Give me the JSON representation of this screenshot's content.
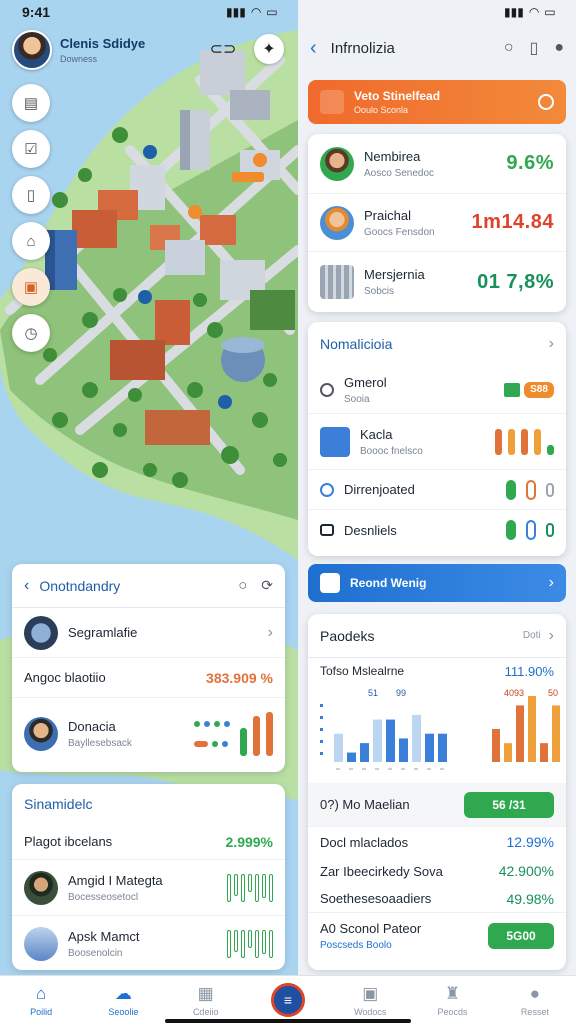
{
  "status": {
    "time_left": "9:41",
    "time_right": ""
  },
  "left": {
    "user": {
      "name": "Clenis Sdidye",
      "sub": "Downess"
    },
    "tools": [
      "doc-icon",
      "checklist-icon",
      "clipboard-icon",
      "bag-icon",
      "gallery-icon",
      "clock-icon"
    ],
    "card1": {
      "title": "Onotndandry",
      "items": [
        {
          "label": "Segramlafie"
        },
        {
          "label": "Angoc blaotiio",
          "value": "383.909 %"
        },
        {
          "label": "Donacia",
          "sub": "Bayllesebsack"
        }
      ]
    },
    "card2": {
      "title": "Sinamidelc",
      "items": [
        {
          "label": "Plagot ibcelans",
          "value": "2.999%"
        },
        {
          "label": "Amgid I Mategta",
          "sub": "Bocesseosetocl"
        },
        {
          "label": "Apsk Mamct",
          "sub": "Boosenolcin"
        }
      ]
    }
  },
  "right": {
    "title": "Infrnolizia",
    "banner": {
      "title": "Veto Stinelfead",
      "sub": "Ooulo Sconla"
    },
    "stats": [
      {
        "label": "Nembirea",
        "sub": "Aosco Senedoc",
        "value": "9.6%",
        "color": "#2fa84f"
      },
      {
        "label": "Praichal",
        "sub": "Goocs Fensdon",
        "value": "1m14.84",
        "color": "#e0422b"
      },
      {
        "label": "Mersjernia",
        "sub": "Sobcis",
        "value": "01 7,8%",
        "color": "#17905a"
      }
    ],
    "card2": {
      "title": "Nomalicioia",
      "items": [
        {
          "label": "Gmerol",
          "sub": "Sooia",
          "badge": "S88"
        },
        {
          "label": "Kacla",
          "sub": "Boooc fnelsco"
        },
        {
          "label": "Dirrenjoated"
        },
        {
          "label": "Desnliels"
        }
      ]
    },
    "blue_banner": {
      "title": "Reond Wenig"
    },
    "card3": {
      "title": "Paodeks",
      "right_label": "Doti",
      "chart_row": {
        "label": "Tofso Mslealrne",
        "value": "111.90%"
      },
      "chart_data": {
        "type": "bar",
        "series": [
          {
            "values": [
              6,
              2,
              4,
              9,
              9,
              5,
              10,
              6,
              6
            ]
          },
          {
            "values": [
              7,
              4,
              12,
              14,
              4,
              12
            ]
          }
        ],
        "labels": [
          "51",
          "99",
          "4093",
          "50"
        ]
      },
      "items": [
        {
          "label": "0?) Mo Maelian",
          "badge": "56 /31"
        },
        {
          "label": "Docl mlaclados",
          "value": "12.99%"
        },
        {
          "label": "Zar Ibeecirkedy Sova",
          "value": "42.900%"
        },
        {
          "label": "Soethesesoaadiers",
          "value": "49.98%"
        },
        {
          "label": "A0 Sconol Pateor",
          "sub": "Poscseds  Boolo",
          "badge": "5G00"
        }
      ]
    }
  },
  "nav": [
    {
      "label": "Poilid",
      "icon": "home-icon"
    },
    {
      "label": "Seoolie",
      "icon": "cloud-icon"
    },
    {
      "label": "Cdeiio",
      "icon": "calendar-icon"
    },
    {
      "label": "",
      "icon": "center-icon"
    },
    {
      "label": "Wodocs",
      "icon": "folder-icon"
    },
    {
      "label": "Peocds",
      "icon": "bell-icon"
    },
    {
      "label": "Resset",
      "icon": "person-icon"
    }
  ]
}
